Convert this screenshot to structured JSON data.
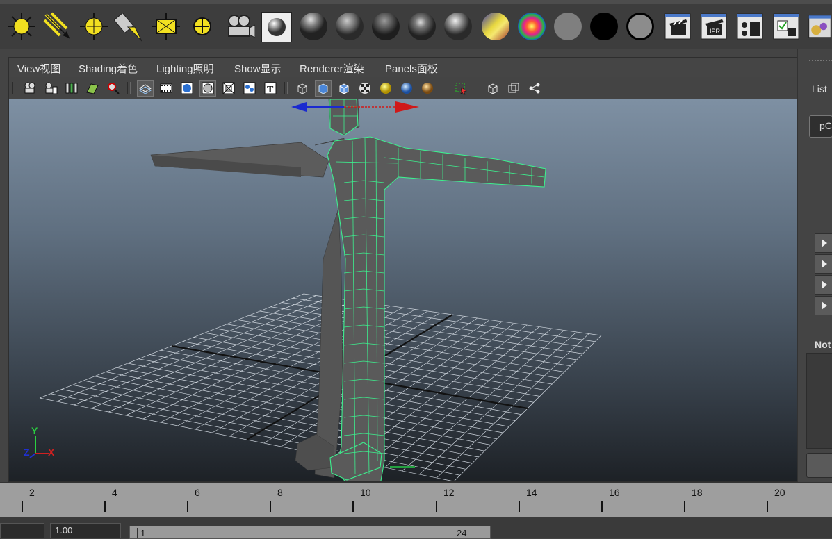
{
  "shelf": {
    "icons": [
      "ambient-light-icon",
      "directional-light-icon",
      "point-light-icon",
      "spot-light-icon",
      "area-light-icon",
      "volume-light-icon",
      "render-camera-icon",
      "material-ball-icon",
      "blinn-sphere-icon",
      "lambert-sphere-icon",
      "phong-sphere-icon",
      "phonge-sphere-icon",
      "anisotropic-sphere-icon",
      "shading-map-icon",
      "ramp-shader-icon",
      "surface-shader-icon",
      "black-shader-icon",
      "layered-shader-icon",
      "render-clapper-icon",
      "ipr-render-icon",
      "render-settings-icon",
      "batch-render-icon",
      "hypershade-icon"
    ]
  },
  "panel": {
    "menus": [
      "View视图",
      "Shading着色",
      "Lighting照明",
      "Show显示",
      "Renderer渲染",
      "Panels面板"
    ]
  },
  "sidebar": {
    "list_label": "List",
    "field_text": "pC",
    "notes_label": "Not"
  },
  "timeline": {
    "ticks": [
      "2",
      "4",
      "6",
      "8",
      "10",
      "12",
      "14",
      "16",
      "18",
      "20"
    ],
    "range_start": "1.00",
    "range_inner_start": "1",
    "range_inner_end": "24"
  },
  "viewport": {
    "axis_labels": {
      "y": "Y",
      "z": "Z",
      "x": "X"
    }
  },
  "colors": {
    "wire_select": "#3df08e",
    "manip_x": "#d01818",
    "manip_z": "#1a2ad0",
    "grid": "#cfd6de",
    "mesh": "#595959"
  }
}
